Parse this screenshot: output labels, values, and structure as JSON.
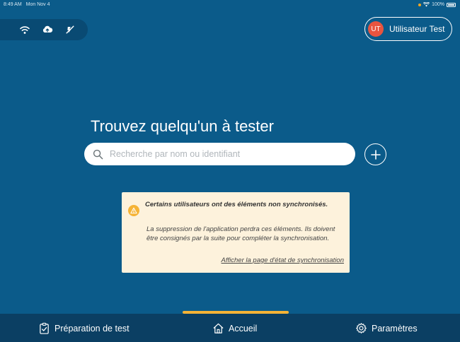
{
  "status_bar": {
    "time": "8:49 AM",
    "date": "Mon Nov 4",
    "battery": "100%"
  },
  "connection_icons": [
    "wifi-icon",
    "cloud-upload-icon",
    "offline-sync-icon"
  ],
  "user": {
    "initials": "UT",
    "name": "Utilisateur Test",
    "avatar_color": "#e8543f"
  },
  "main": {
    "heading": "Trouvez quelqu'un à tester",
    "search_placeholder": "Recherche par nom ou identifiant"
  },
  "warning": {
    "title": "Certains utilisateurs ont des éléments non synchronisés.",
    "body": "La suppression de l'application perdra ces éléments. Ils doivent être consignés par la suite pour compléter la synchronisation.",
    "link": "Afficher la page d'état de synchronisation"
  },
  "tabs": [
    {
      "label": "Préparation de test",
      "icon": "clipboard-check-icon"
    },
    {
      "label": "Accueil",
      "icon": "home-icon",
      "active": true
    },
    {
      "label": "Paramètres",
      "icon": "gear-icon"
    }
  ],
  "colors": {
    "background": "#0b5b8a",
    "tab_bar": "#0b3f63",
    "accent": "#f5b336",
    "warning_bg": "#fdf2dc"
  }
}
